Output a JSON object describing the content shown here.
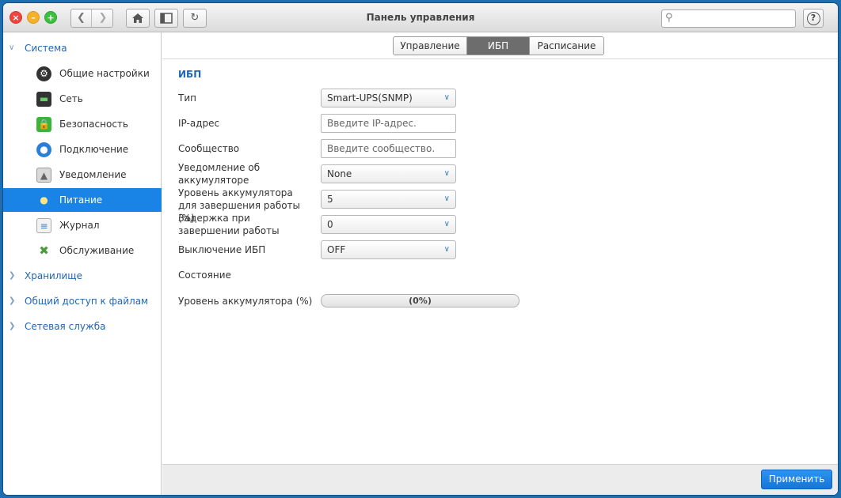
{
  "window": {
    "title": "Панель управления"
  },
  "search": {
    "placeholder": ""
  },
  "sidebar": {
    "sections": [
      {
        "label": "Система",
        "expanded": true
      },
      {
        "label": "Хранилище",
        "expanded": false
      },
      {
        "label": "Общий доступ к файлам",
        "expanded": false
      },
      {
        "label": "Сетевая служба",
        "expanded": false
      }
    ],
    "items": [
      {
        "label": "Общие настройки",
        "icon": "gear-icon"
      },
      {
        "label": "Сеть",
        "icon": "network-icon"
      },
      {
        "label": "Безопасность",
        "icon": "lock-icon"
      },
      {
        "label": "Подключение",
        "icon": "globe-icon"
      },
      {
        "label": "Уведомление",
        "icon": "bell-icon"
      },
      {
        "label": "Питание",
        "icon": "lightbulb-icon",
        "active": true
      },
      {
        "label": "Журнал",
        "icon": "log-icon"
      },
      {
        "label": "Обслуживание",
        "icon": "tools-icon"
      }
    ]
  },
  "tabs": [
    {
      "label": "Управление"
    },
    {
      "label": "ИБП",
      "active": true
    },
    {
      "label": "Расписание"
    }
  ],
  "form": {
    "section_title": "ИБП",
    "type_label": "Тип",
    "type_value": "Smart-UPS(SNMP)",
    "ip_label": "IP-адрес",
    "ip_placeholder": "Введите IP-адрес.",
    "community_label": "Сообщество",
    "community_placeholder": "Введите сообщество.",
    "battery_notify_label": "Уведомление об аккумуляторе",
    "battery_notify_value": "None",
    "shutdown_level_label": "Уровень аккумулятора для завершения работы (%)",
    "shutdown_level_value": "5",
    "shutdown_delay_label": "Задержка при завершении работы",
    "shutdown_delay_value": "0",
    "ups_off_label": "Выключение ИБП",
    "ups_off_value": "OFF",
    "status_label": "Состояние",
    "battery_level_label": "Уровень аккумулятора (%)",
    "battery_level_text": "(0%)",
    "battery_level_fraction": 0
  },
  "footer": {
    "apply_label": "Применить"
  },
  "colors": {
    "accent": "#1a84e6",
    "section_text": "#1f66b3",
    "desktop": "#1f6fb0"
  }
}
